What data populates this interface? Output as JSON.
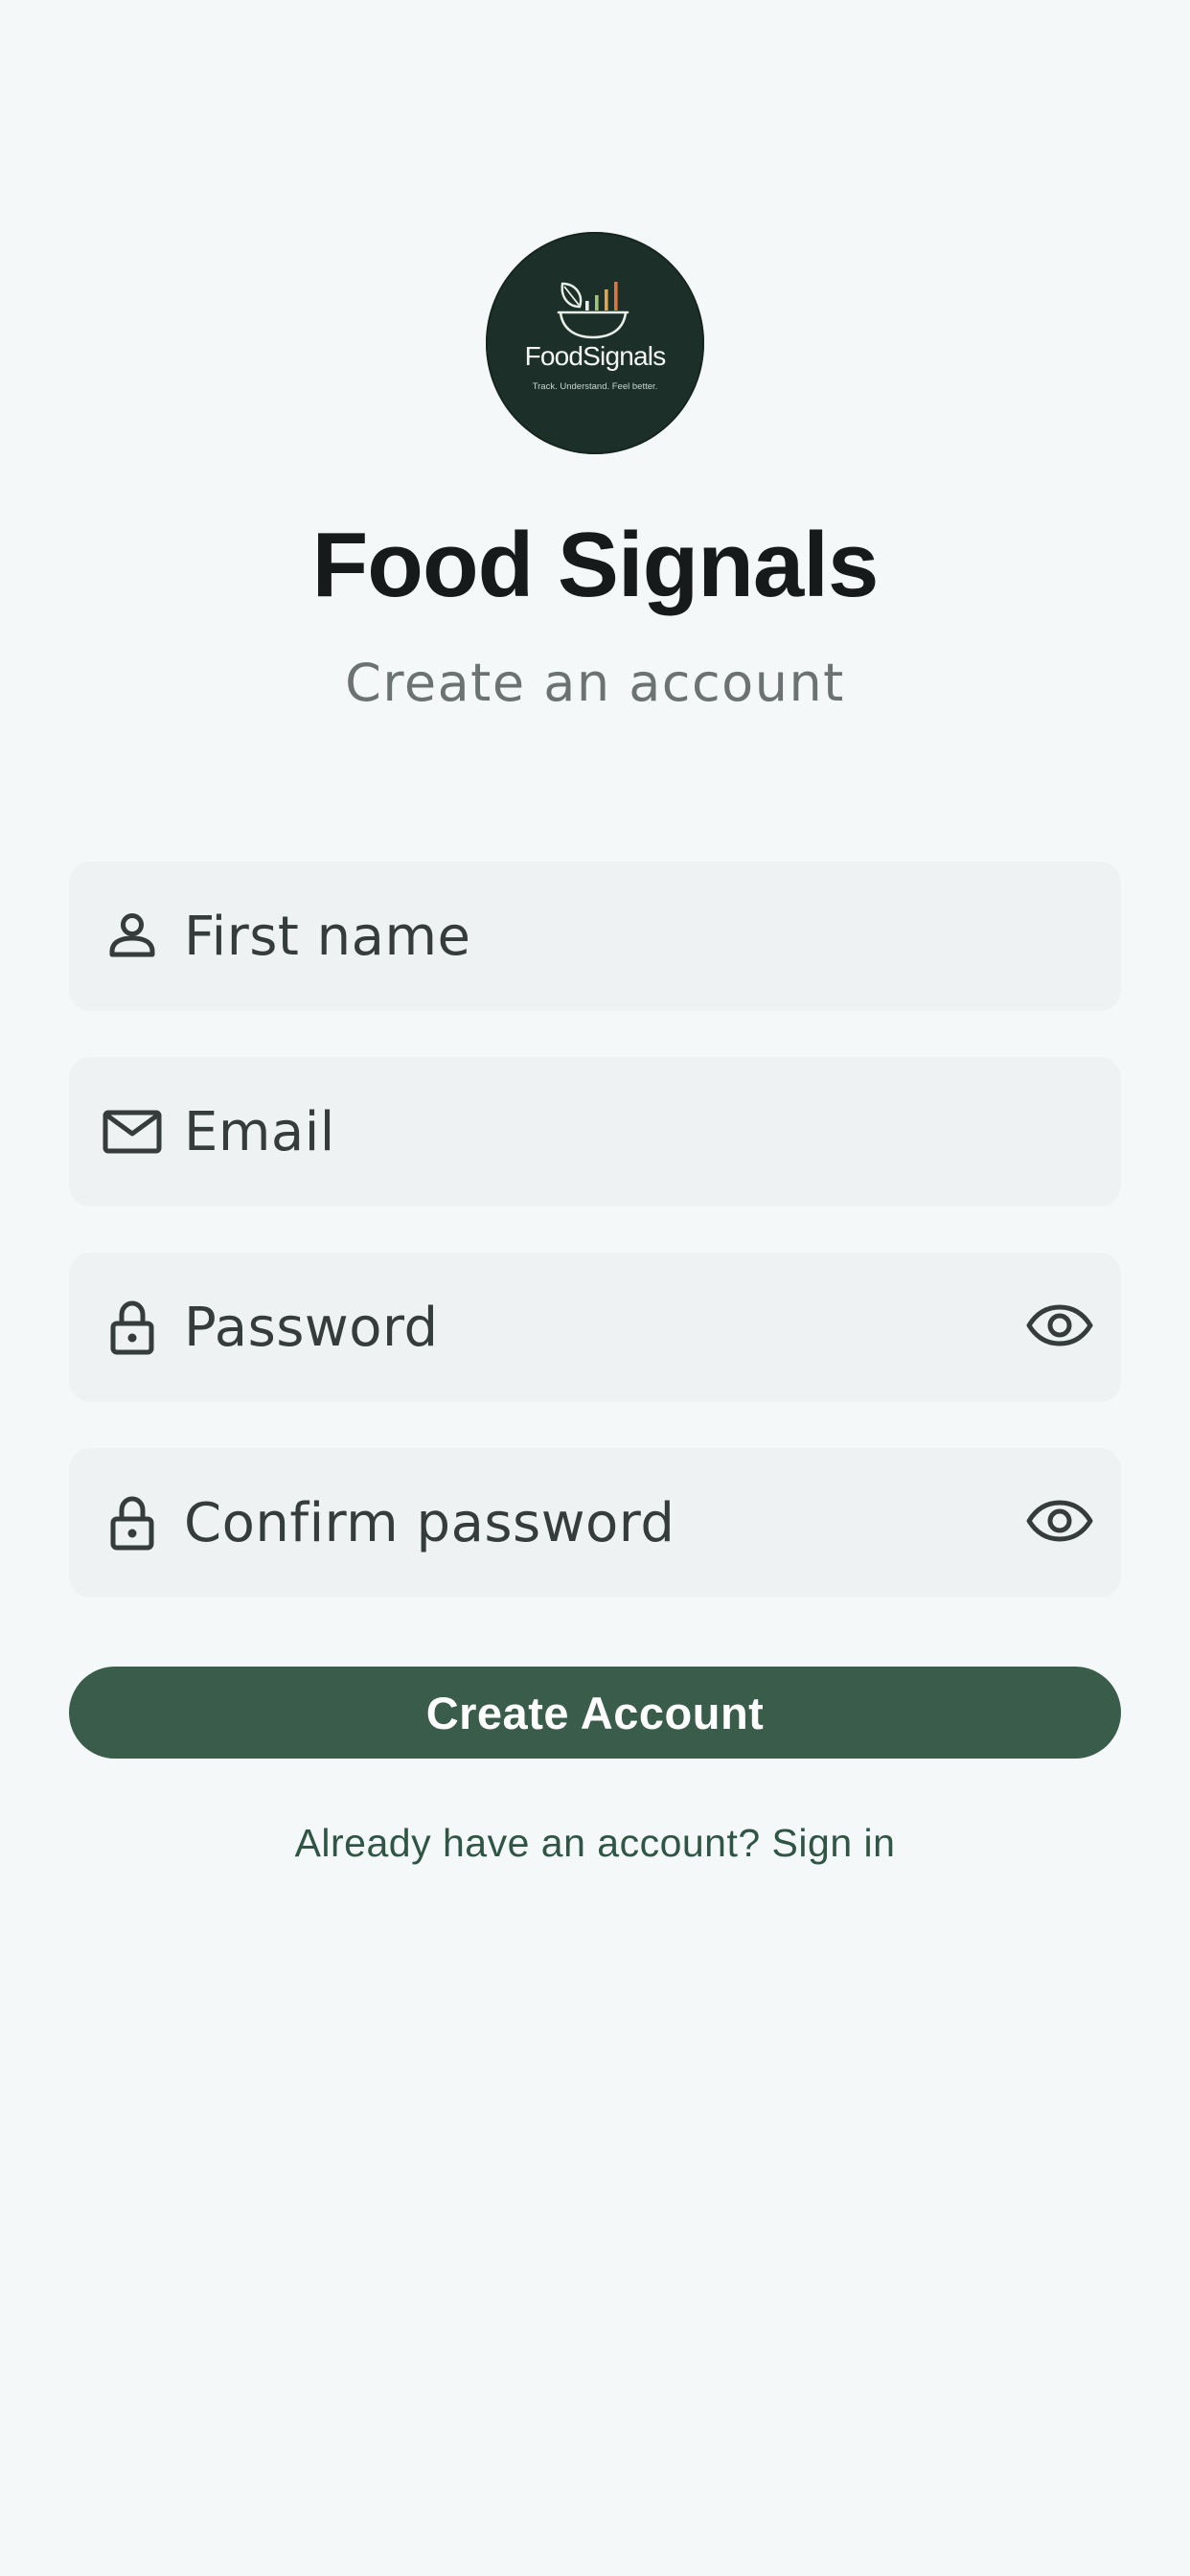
{
  "logo": {
    "wordmark": "FoodSignals",
    "tagline": "Track. Understand. Feel better."
  },
  "header": {
    "title": "Food Signals",
    "subtitle": "Create an account"
  },
  "form": {
    "first_name": {
      "placeholder": "First name",
      "icon": "person-icon"
    },
    "email": {
      "placeholder": "Email",
      "icon": "envelope-icon"
    },
    "password": {
      "placeholder": "Password",
      "icon": "lock-icon",
      "toggle_icon": "eye-icon"
    },
    "confirm_password": {
      "placeholder": "Confirm password",
      "icon": "lock-icon",
      "toggle_icon": "eye-icon"
    },
    "submit_label": "Create Account"
  },
  "footer": {
    "signin_prompt": "Already have an account? Sign in"
  },
  "colors": {
    "background": "#f5f8f9",
    "field": "#eff2f3",
    "primary": "#3a5c4b",
    "logo_bg": "#1c3029",
    "link": "#2f5545"
  }
}
